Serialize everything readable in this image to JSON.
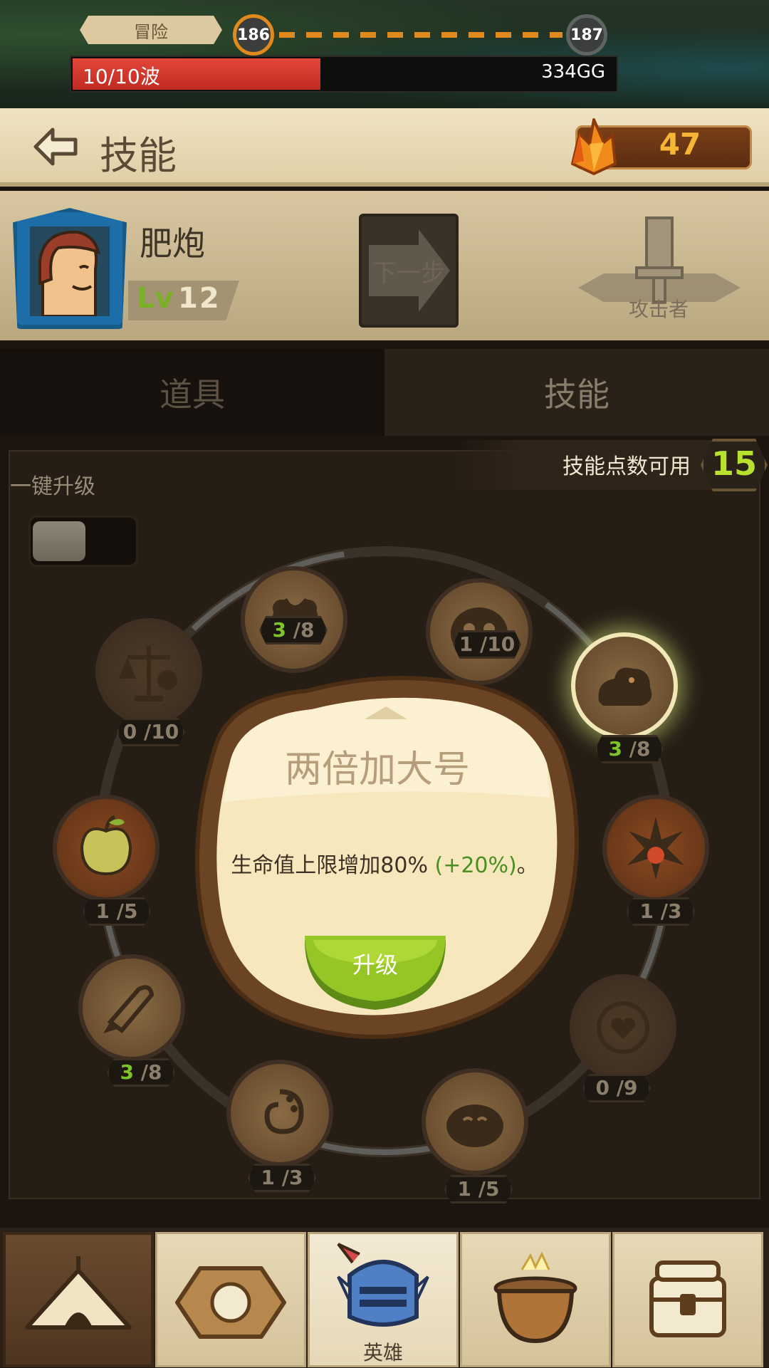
{
  "top_bar": {
    "mode_label": "冒险",
    "current_level": "186",
    "next_level": "187",
    "wave_text": "10/10波",
    "gold_text": "334GG"
  },
  "header": {
    "title": "技能",
    "crystal_count": "47"
  },
  "hero": {
    "name": "肥炮",
    "level_prefix": "Lv",
    "level": "12",
    "next_step_label": "下一步",
    "role": "攻击者"
  },
  "tabs": [
    {
      "label": "道具",
      "active": false
    },
    {
      "label": "技能",
      "active": true
    }
  ],
  "skills_panel": {
    "points_label": "技能点数可用",
    "points_value": "15",
    "auto_upgrade_label": "一键升级",
    "auto_upgrade_on": false
  },
  "skill_nodes": [
    {
      "icon": "muscle-icon",
      "current": "3",
      "max": "8",
      "active": true
    },
    {
      "icon": "pumpkin-skull-icon",
      "current": "1",
      "max": "10",
      "active": false
    },
    {
      "icon": "scales-icon",
      "current": "0",
      "max": "10",
      "active": false
    },
    {
      "icon": "cloud-creature-icon",
      "current": "3",
      "max": "8",
      "active": true
    },
    {
      "icon": "apple-icon",
      "current": "1",
      "max": "5",
      "active": false
    },
    {
      "icon": "explosion-icon",
      "current": "1",
      "max": "3",
      "active": false
    },
    {
      "icon": "broken-rocket-icon",
      "current": "3",
      "max": "8",
      "active": true
    },
    {
      "icon": "heart-target-icon",
      "current": "0",
      "max": "9",
      "active": false
    },
    {
      "icon": "swirl-icon",
      "current": "1",
      "max": "3",
      "active": false
    },
    {
      "icon": "smiling-face-icon",
      "current": "1",
      "max": "5",
      "active": false
    }
  ],
  "popup": {
    "title": "两倍加大号",
    "desc_prefix": "生命值上限增加80%",
    "desc_bonus": "(+20%)",
    "desc_suffix": "。",
    "button_label": "升级"
  },
  "bottom_nav": [
    {
      "icon": "tent-icon",
      "label": ""
    },
    {
      "icon": "hex-rune-icon",
      "label": ""
    },
    {
      "icon": "knight-helmet-icon",
      "label": "英雄"
    },
    {
      "icon": "cauldron-icon",
      "label": ""
    },
    {
      "icon": "treasure-chest-icon",
      "label": ""
    }
  ],
  "colors": {
    "accent_orange": "#e08a1d",
    "points_green": "#b8e02f",
    "active_count_green": "#7ec22c",
    "upgrade_button_green": "#8cc21f",
    "wave_red": "#d0372c"
  }
}
